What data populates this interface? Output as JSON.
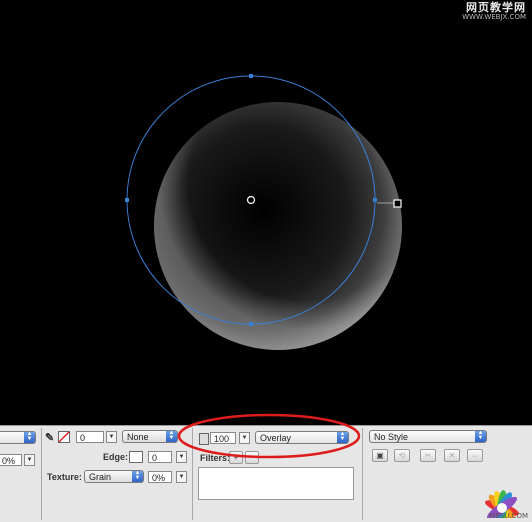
{
  "watermark": {
    "cn": "网页教学网",
    "url": "WWW.WEBJX.COM"
  },
  "bottom_watermark": "MBSU.COM",
  "colors": {
    "canvas": "#000000",
    "selection": "#3a7fd5",
    "panel": "#e6e6e6",
    "highlight_oval": "#dd1c1c"
  },
  "properties": {
    "stroke": {
      "pencil_icon": "pencil-icon",
      "no_stroke_icon": "no-stroke-swatch-icon",
      "stroke_size": "0",
      "stroke_type": "None",
      "edge_label": "Edge:",
      "edge_value": "0",
      "texture_label": "Texture:",
      "texture_name": "Grain",
      "texture_amount": "0%",
      "left_value": "0%"
    },
    "effects": {
      "opacity": "100",
      "blend_mode": "Overlay",
      "filters_label": "Filters:",
      "add_filter_icon": "plus-icon"
    },
    "style": {
      "style_name": "No Style",
      "buttons": [
        "new-style-icon",
        "redefine-style-icon",
        "break-link-icon",
        "delete-style-icon",
        "style-options-icon"
      ]
    }
  }
}
